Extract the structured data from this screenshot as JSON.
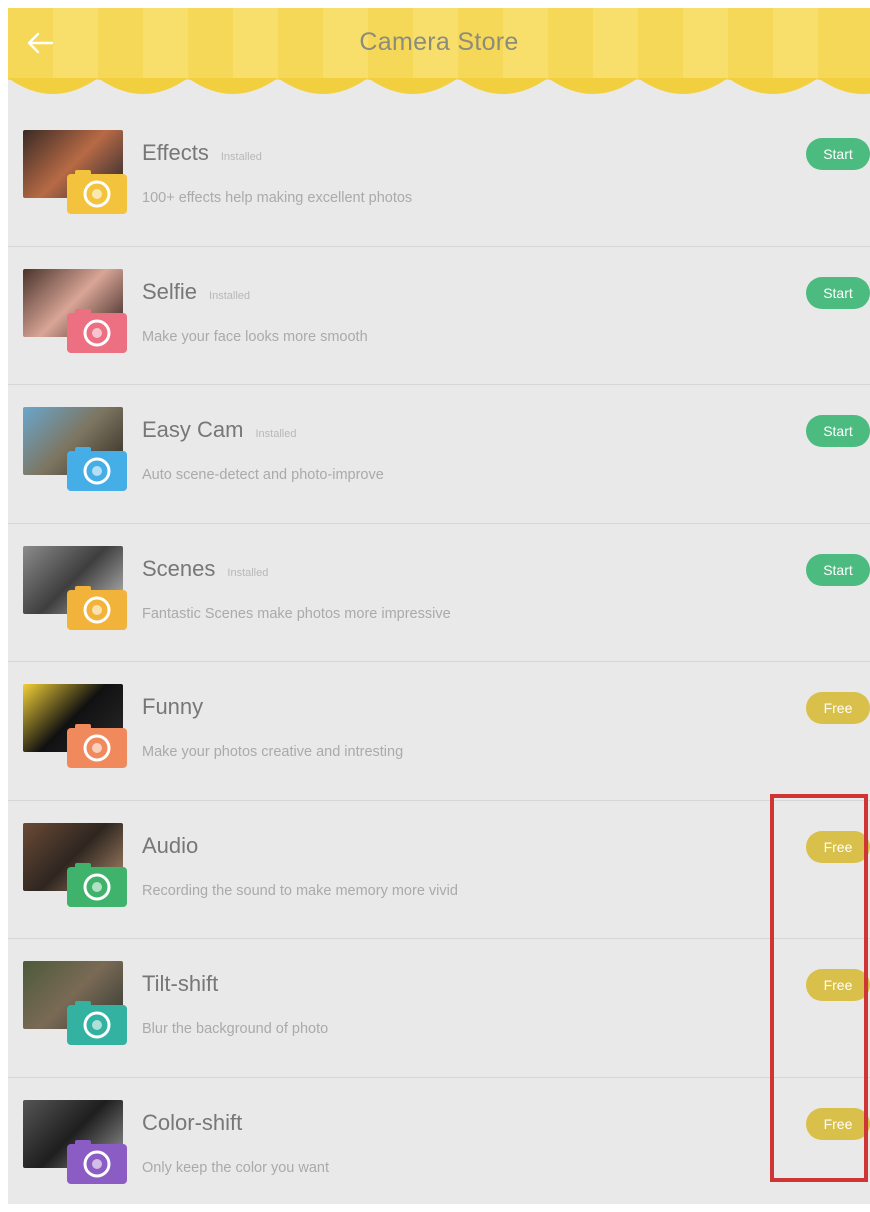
{
  "header": {
    "title": "Camera Store",
    "back_icon": "arrow-left-icon",
    "awning_colors": [
      "#f9e27a",
      "#f4d24b"
    ]
  },
  "items": [
    {
      "name": "Effects",
      "status": "Installed",
      "description": "100+ effects help making excellent photos",
      "action": "Start",
      "action_type": "start",
      "icon": "effects-camera-icon",
      "icon_color": "#f4c33d",
      "photo_colors": [
        "#3a2a25",
        "#b86a45",
        "#1f2630"
      ]
    },
    {
      "name": "Selfie",
      "status": "Installed",
      "description": "Make your face looks more smooth",
      "action": "Start",
      "action_type": "start",
      "icon": "selfie-camera-icon",
      "icon_color": "#ec6f82",
      "photo_colors": [
        "#4a332b",
        "#d9a596",
        "#2e1e1a"
      ]
    },
    {
      "name": "Easy Cam",
      "status": "Installed",
      "description": "Auto scene-detect and photo-improve",
      "action": "Start",
      "action_type": "start",
      "icon": "easycam-camera-icon",
      "icon_color": "#46aee6",
      "photo_colors": [
        "#6aa6cc",
        "#7d7560",
        "#2f2a22"
      ]
    },
    {
      "name": "Scenes",
      "status": "Installed",
      "description": "Fantastic Scenes make photos more impressive",
      "action": "Start",
      "action_type": "start",
      "icon": "scenes-camera-icon",
      "icon_color": "#f2b33b",
      "photo_colors": [
        "#8b8b8b",
        "#3e3e3e",
        "#c2c2c2"
      ]
    },
    {
      "name": "Funny",
      "status": "",
      "description": "Make your photos creative and intresting",
      "action": "Free",
      "action_type": "free",
      "icon": "funny-camera-icon",
      "icon_color": "#f08a5d",
      "photo_colors": [
        "#f2d037",
        "#111111",
        "#2a2a2a"
      ]
    },
    {
      "name": "Audio",
      "status": "",
      "description": "Recording the sound to make memory more vivid",
      "action": "Free",
      "action_type": "free",
      "icon": "audio-camera-icon",
      "icon_color": "#3fb36b",
      "photo_colors": [
        "#6a4a35",
        "#2e2620",
        "#b08a6a"
      ]
    },
    {
      "name": "Tilt-shift",
      "status": "",
      "description": "Blur the background of photo",
      "action": "Free",
      "action_type": "free",
      "icon": "tiltshift-camera-icon",
      "icon_color": "#33b2a1",
      "photo_colors": [
        "#4d5a3a",
        "#7a6a55",
        "#333833"
      ]
    },
    {
      "name": "Color-shift",
      "status": "",
      "description": "Only keep the color you want",
      "action": "Free",
      "action_type": "free",
      "icon": "colorshift-camera-icon",
      "icon_color": "#8a5cc4",
      "photo_colors": [
        "#555555",
        "#1e1e1e",
        "#9a9a9a"
      ]
    }
  ]
}
